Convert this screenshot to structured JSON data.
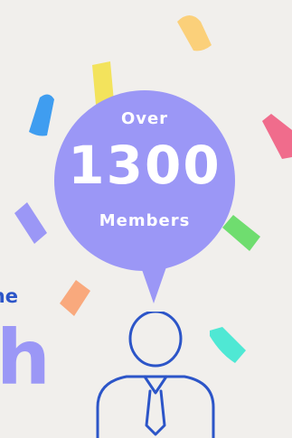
{
  "bubble": {
    "top_text": "Over",
    "number": "1300",
    "bottom_text": "Members"
  },
  "left_fragments": {
    "small": "ne",
    "big": "h"
  },
  "colors": {
    "background": "#f1efec",
    "bubble": "#9b97f6",
    "person_outline": "#2c55c8",
    "confetti": [
      "#fbd07a",
      "#f3e35c",
      "#3f9df0",
      "#f06c8c",
      "#9b97f6",
      "#6fdd6f",
      "#f9a97d",
      "#4fe8d4"
    ]
  },
  "icons": [
    "person-icon"
  ]
}
